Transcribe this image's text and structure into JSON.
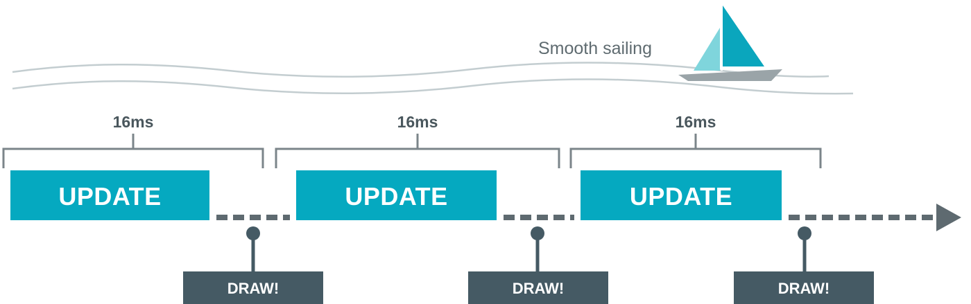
{
  "caption": "Smooth sailing",
  "frames": [
    {
      "duration": "16ms",
      "update": "UPDATE",
      "draw": "DRAW!"
    },
    {
      "duration": "16ms",
      "update": "UPDATE",
      "draw": "DRAW!"
    },
    {
      "duration": "16ms",
      "update": "UPDATE",
      "draw": "DRAW!"
    }
  ],
  "colors": {
    "update": "#05a9c0",
    "draw": "#455a64",
    "timeline": "#5e6a70",
    "bracket": "#7b858a",
    "wave": "#c3cdd0",
    "sail_main": "#0aa6bd",
    "sail_front": "#7fd5dc",
    "hull": "#9aa4a8"
  },
  "icons": [
    "sailboat-icon",
    "wave-lines",
    "timeline-arrow-icon"
  ]
}
